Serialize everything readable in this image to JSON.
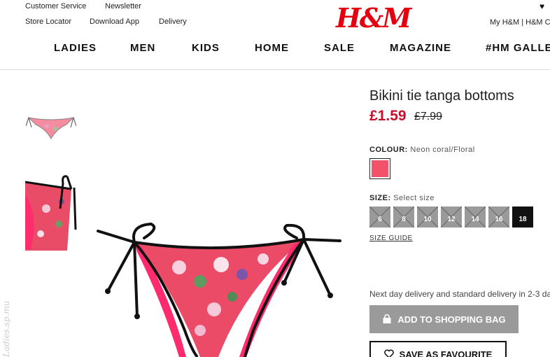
{
  "header": {
    "top_links_left": [
      "Customer Service",
      "Newsletter"
    ],
    "top_links_left2": [
      "Store Locator",
      "Download App",
      "Delivery"
    ],
    "logo": "H&M",
    "account_links": "My H&M | H&M Cl"
  },
  "nav": {
    "items": [
      "LADIES",
      "MEN",
      "KIDS",
      "HOME",
      "SALE",
      "MAGAZINE",
      "#HM GALLE"
    ]
  },
  "watermark": "Ladies.sp.mu",
  "product": {
    "title": "Bikini tie tanga bottoms",
    "price": "£1.59",
    "old_price": "£7.99",
    "colour_label": "COLOUR:",
    "colour_value": "Neon coral/Floral",
    "size_label": "SIZE:",
    "size_placeholder": "Select size",
    "sizes": [
      {
        "label": "6",
        "available": false
      },
      {
        "label": "8",
        "available": false
      },
      {
        "label": "10",
        "available": false
      },
      {
        "label": "12",
        "available": false
      },
      {
        "label": "14",
        "available": false
      },
      {
        "label": "16",
        "available": false
      },
      {
        "label": "18",
        "available": true
      }
    ],
    "size_guide": "SIZE GUIDE",
    "delivery_text": "Next day delivery and standard delivery in 2-3 da",
    "add_to_bag": "ADD TO SHOPPING BAG",
    "save_favourite": "SAVE AS FAVOURITE"
  },
  "colors": {
    "brand_red": "#e50010",
    "price_red": "#c8102e",
    "swatch": "#f35069",
    "button_grey": "#9a9a9a"
  }
}
